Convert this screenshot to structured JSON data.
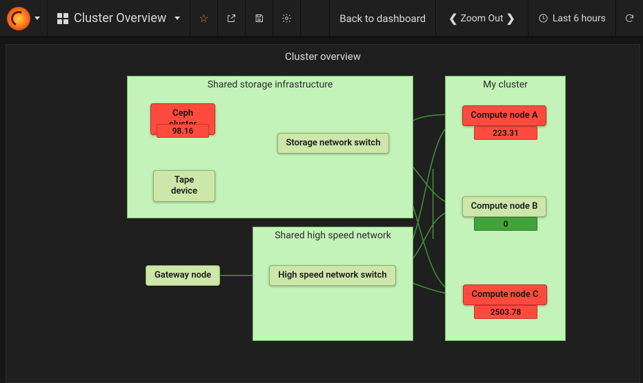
{
  "navbar": {
    "dashboard_title": "Cluster Overview",
    "back_label": "Back to dashboard",
    "zoom_label": "Zoom Out",
    "timerange_label": "Last 6 hours"
  },
  "panel": {
    "title": "Cluster overview"
  },
  "groups": {
    "storage": {
      "title": "Shared storage infrastructure"
    },
    "network": {
      "title": "Shared high speed network"
    },
    "cluster": {
      "title": "My cluster"
    }
  },
  "nodes": {
    "ceph": {
      "label": "Ceph cluster",
      "status": "critical",
      "value": "98.16"
    },
    "tape": {
      "label": "Tape device",
      "status": "ok"
    },
    "stswitch": {
      "label": "Storage network switch",
      "status": "ok"
    },
    "gateway": {
      "label": "Gateway node",
      "status": "ok"
    },
    "hsswitch": {
      "label": "High speed network switch",
      "status": "ok"
    },
    "compA": {
      "label": "Compute node A",
      "status": "critical",
      "value": "223.31"
    },
    "compB": {
      "label": "Compute node B",
      "status": "ok",
      "value": "0"
    },
    "compC": {
      "label": "Compute node C",
      "status": "critical",
      "value": "2503.78"
    }
  },
  "chart_data": {
    "type": "table",
    "title": "Cluster overview",
    "series": [
      {
        "name": "Ceph cluster",
        "value": 98.16,
        "status": "critical"
      },
      {
        "name": "Compute node A",
        "value": 223.31,
        "status": "critical"
      },
      {
        "name": "Compute node B",
        "value": 0,
        "status": "ok"
      },
      {
        "name": "Compute node C",
        "value": 2503.78,
        "status": "critical"
      }
    ]
  }
}
